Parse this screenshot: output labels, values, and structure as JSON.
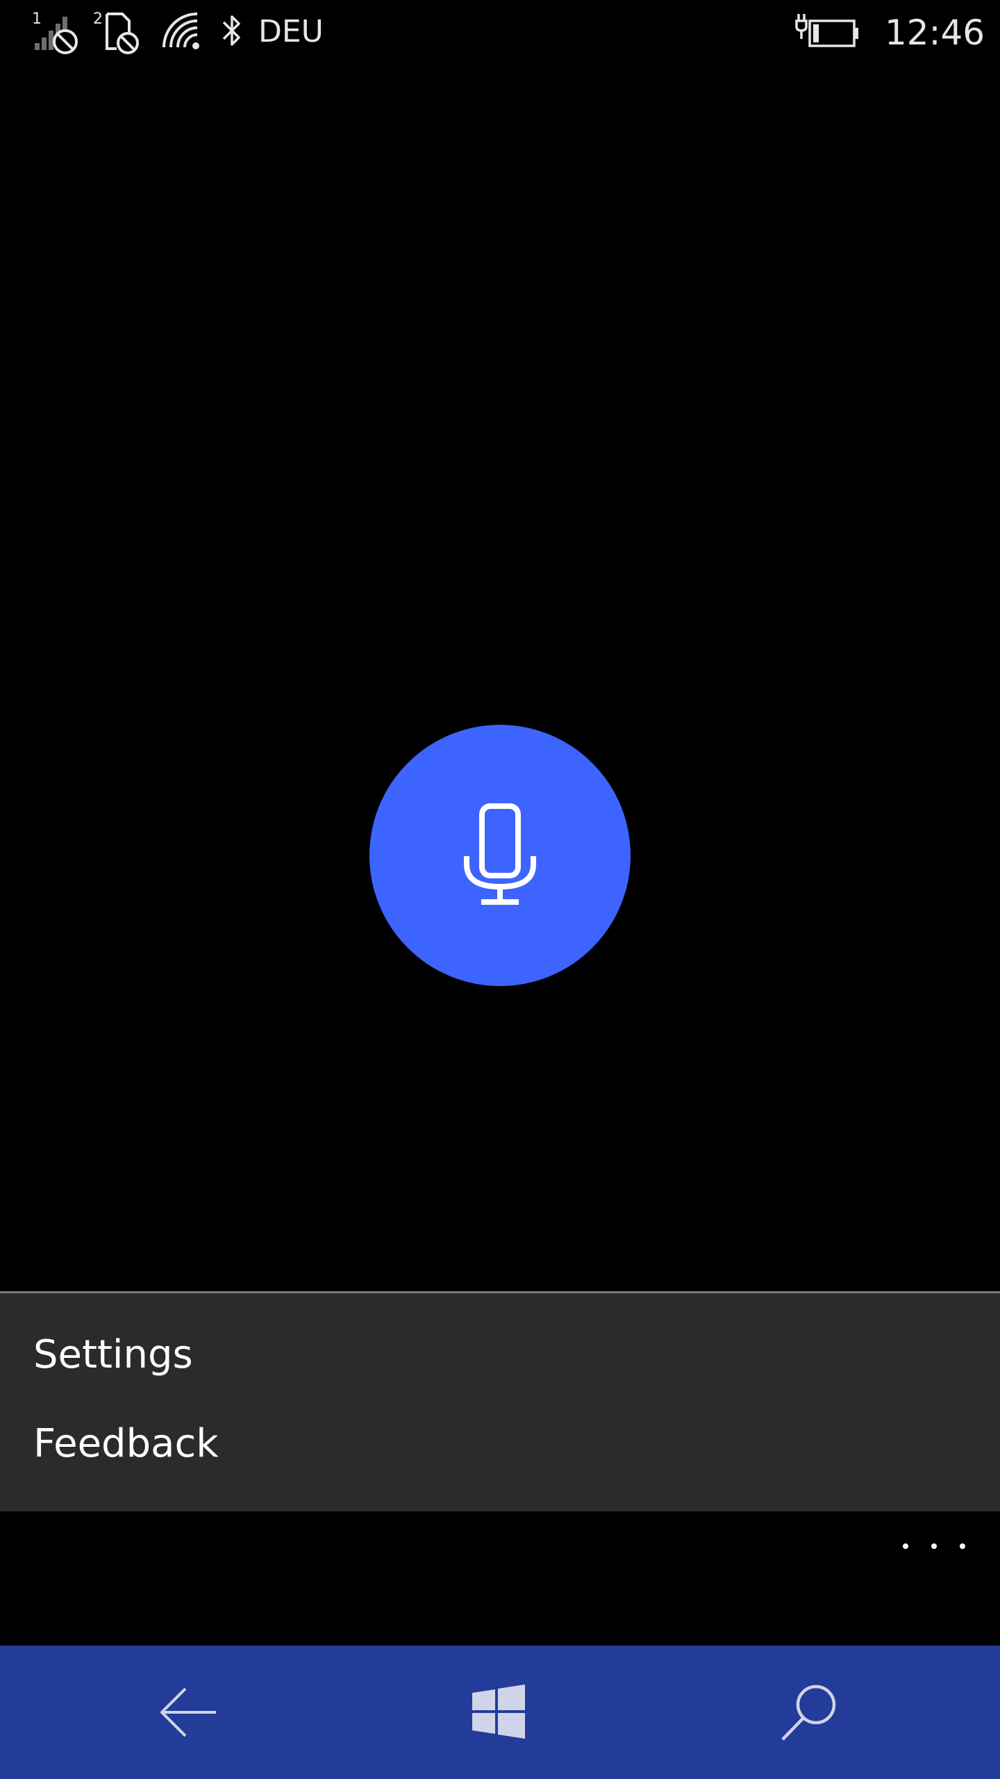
{
  "status_bar": {
    "sim1_label": "1",
    "sim2_label": "2",
    "input_language": "DEU",
    "time": "12:46",
    "icons": [
      "signal-sim1-no-service-icon",
      "sim2-no-sim-icon",
      "wifi-icon",
      "bluetooth-icon",
      "battery-charging-icon"
    ]
  },
  "mic": {
    "icon": "microphone-icon",
    "color": "#3e64ff"
  },
  "app_bar": {
    "menu_items": [
      {
        "label": "Settings"
      },
      {
        "label": "Feedback"
      }
    ],
    "more_icon": "ellipsis-icon",
    "background": "#2b2b2b"
  },
  "nav_bar": {
    "background": "#233c99",
    "buttons": [
      "back-arrow-icon",
      "windows-start-icon",
      "search-icon"
    ]
  }
}
